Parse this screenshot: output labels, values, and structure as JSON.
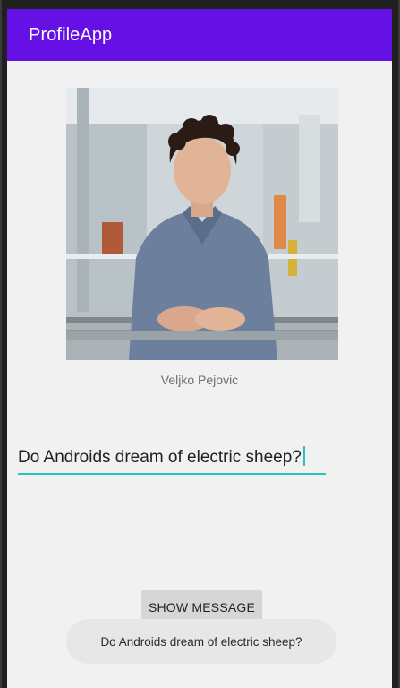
{
  "app_bar": {
    "title": "ProfileApp",
    "color": "#6510E4"
  },
  "profile": {
    "name": "Veljko Pejovic",
    "photo_icon": "profile-photo"
  },
  "input": {
    "value": "Do Androids dream of electric sheep?",
    "accent": "#20C6B8"
  },
  "button": {
    "label": "SHOW MESSAGE"
  },
  "toast": {
    "message": "Do Androids dream of electric sheep?"
  }
}
